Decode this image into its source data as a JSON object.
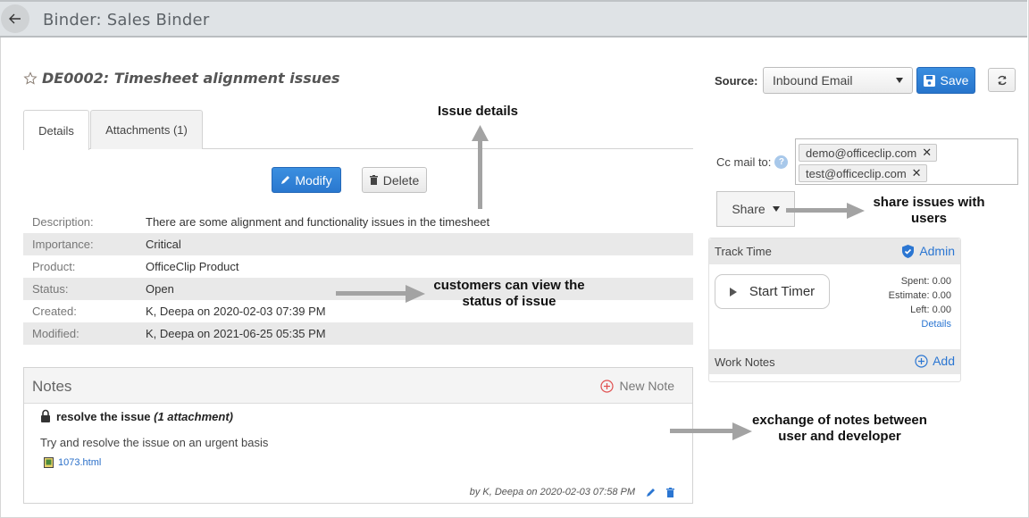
{
  "header": {
    "title": "Binder: Sales Binder",
    "back_icon": "arrow-left-icon"
  },
  "issue": {
    "title": "DE0002: Timesheet alignment issues",
    "star_icon": "star-outline-icon"
  },
  "tabs": [
    {
      "label": "Details",
      "active": true
    },
    {
      "label": "Attachments (1)",
      "active": false
    }
  ],
  "actions": {
    "modify_label": "Modify",
    "delete_label": "Delete"
  },
  "details": [
    {
      "label": "Description:",
      "value": "There are some alignment and functionality issues in the timesheet"
    },
    {
      "label": "Importance:",
      "value": "Critical"
    },
    {
      "label": "Product:",
      "value": "OfficeClip Product"
    },
    {
      "label": "Status:",
      "value": "Open"
    },
    {
      "label": "Created:",
      "value": "K, Deepa on 2020-02-03 07:39 PM"
    },
    {
      "label": "Modified:",
      "value": "K, Deepa on 2021-06-25 05:35 PM"
    }
  ],
  "notes": {
    "title": "Notes",
    "new_note_label": "New Note",
    "items": [
      {
        "title": "resolve the issue",
        "attachment_count": "(1 attachment)",
        "body": "Try and resolve the issue on an urgent basis",
        "attachment": "1073.html",
        "meta": "by  K, Deepa on  2020-02-03 07:58 PM"
      }
    ]
  },
  "source": {
    "label": "Source:",
    "selected": "Inbound Email",
    "save_label": "Save"
  },
  "cc": {
    "label": "Cc mail to:",
    "help": "?",
    "emails": [
      "demo@officeclip.com",
      "test@officeclip.com"
    ],
    "remove_glyph": "✕"
  },
  "share": {
    "label": "Share"
  },
  "track_time": {
    "title": "Track Time",
    "admin_label": "Admin",
    "start_timer_label": "Start Timer",
    "spent": "Spent: 0.00",
    "estimate": "Estimate: 0.00",
    "left": "Left: 0.00",
    "details_label": "Details",
    "work_notes_label": "Work Notes",
    "add_label": "Add"
  },
  "annotations": {
    "issue_details": "Issue details",
    "share_line1": "share issues with",
    "share_line2": "users",
    "status_line1": "customers can view the",
    "status_line2": "status of issue",
    "notes_line1": "exchange of notes between",
    "notes_line2": "user and developer"
  },
  "colors": {
    "primary": "#2a78cf",
    "link": "#2b76d2",
    "danger_icon": "#e05050",
    "header_bg": "#dfe3e6"
  }
}
